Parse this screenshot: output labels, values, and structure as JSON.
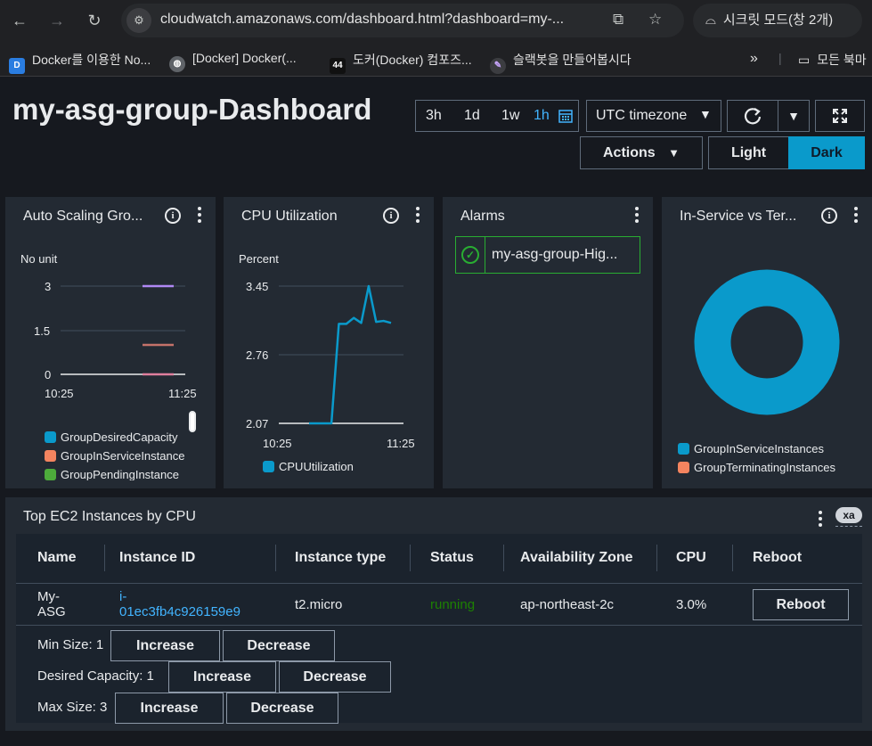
{
  "browser": {
    "url": "cloudwatch.amazonaws.com/dashboard.html?dashboard=my-...",
    "incognito_label": "시크릿 모드(창 2개)",
    "bookmarks": [
      {
        "label": "Docker를 이용한 No...",
        "icon": "dale-logo-icon"
      },
      {
        "label": "[Docker] Docker(...",
        "icon": "globe-icon"
      },
      {
        "label": "도커(Docker) 컴포즈...",
        "icon": "44-badge-icon"
      },
      {
        "label": "슬랙봇을 만들어봅시다",
        "icon": "feather-icon"
      }
    ],
    "bookmark_more": "»",
    "all_bookmarks": "모든 북마"
  },
  "dashboard": {
    "title": "my-asg-group-Dashboard",
    "time_ranges": [
      "3h",
      "1d",
      "1w",
      "1h"
    ],
    "active_range": "1h",
    "timezone": "UTC timezone",
    "actions_label": "Actions",
    "light_label": "Light",
    "dark_label": "Dark"
  },
  "widgets": {
    "asg": {
      "title": "Auto Scaling Gro...",
      "unit": "No unit",
      "yticks": [
        "3",
        "1.5",
        "0"
      ],
      "xticks": [
        "10:25",
        "11:25"
      ],
      "legend": [
        {
          "name": "GroupDesiredCapacity",
          "color": "#0a9acb"
        },
        {
          "name": "GroupInServiceInstance",
          "color": "#f4845f"
        },
        {
          "name": "GroupPendingInstance",
          "color": "#4dab3b"
        }
      ]
    },
    "cpu": {
      "title": "CPU Utilization",
      "unit": "Percent",
      "yticks": [
        "3.45",
        "2.76",
        "2.07"
      ],
      "xticks": [
        "10:25",
        "11:25"
      ],
      "legend": [
        {
          "name": "CPUUtilization",
          "color": "#0a9acb"
        }
      ]
    },
    "alarms": {
      "title": "Alarms",
      "alarm_name": "my-asg-group-Hig..."
    },
    "inservice": {
      "title": "In-Service vs Ter...",
      "legend": [
        {
          "name": "GroupInServiceInstances",
          "color": "#0a9acb"
        },
        {
          "name": "GroupTerminatingInstances",
          "color": "#f4845f"
        }
      ]
    }
  },
  "chart_data": [
    {
      "type": "line",
      "title": "Auto Scaling Gro...",
      "ylabel": "No unit",
      "ylim": [
        0,
        3
      ],
      "x": [
        "10:25",
        "11:25"
      ],
      "series": [
        {
          "name": "GroupDesiredCapacity",
          "values": [
            1,
            1
          ]
        },
        {
          "name": "GroupInServiceInstance",
          "values": [
            0,
            0
          ]
        },
        {
          "name": "GroupPendingInstance",
          "values": [
            0,
            0
          ]
        }
      ]
    },
    {
      "type": "line",
      "title": "CPU Utilization",
      "ylabel": "Percent",
      "ylim": [
        2.07,
        3.45
      ],
      "x": [
        "10:25",
        "11:25"
      ],
      "series": [
        {
          "name": "CPUUtilization",
          "values": [
            2.07,
            2.07,
            2.07,
            2.07,
            3.07,
            3.07,
            3.13,
            3.08,
            3.45,
            3.09,
            3.1,
            3.08
          ]
        }
      ]
    },
    {
      "type": "pie",
      "title": "In-Service vs Ter...",
      "categories": [
        "GroupInServiceInstances",
        "GroupTerminatingInstances"
      ],
      "values": [
        1,
        0
      ]
    }
  ],
  "table": {
    "title": "Top EC2 Instances by CPU",
    "badge": "xa",
    "headers": [
      "Name",
      "Instance ID",
      "Instance type",
      "Status",
      "Availability Zone",
      "CPU",
      "Reboot"
    ],
    "row": {
      "name_line1": "My-",
      "name_line2": "ASG",
      "id_line1": "i-",
      "id_line2": "01ec3fb4c926159e9",
      "type": "t2.micro",
      "status": "running",
      "az": "ap-northeast-2c",
      "cpu": "3.0%",
      "reboot_label": "Reboot"
    },
    "controls": [
      {
        "label": "Min Size: 1",
        "increase": "Increase",
        "decrease": "Decrease"
      },
      {
        "label": "Desired Capacity: 1",
        "increase": "Increase",
        "decrease": "Decrease"
      },
      {
        "label": "Max Size: 3",
        "increase": "Increase",
        "decrease": "Decrease"
      }
    ]
  }
}
